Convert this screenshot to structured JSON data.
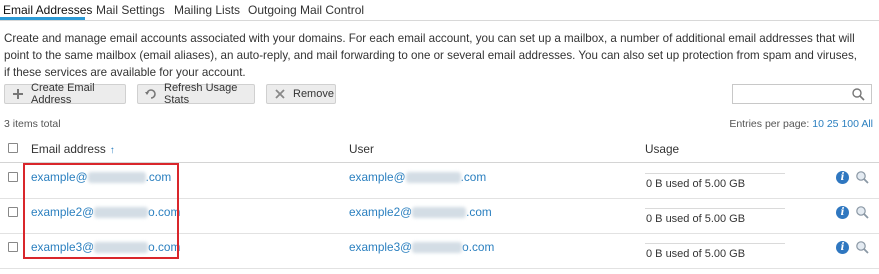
{
  "tabs": [
    {
      "label": "Email Addresses",
      "active": true
    },
    {
      "label": "Mail Settings",
      "active": false
    },
    {
      "label": "Mailing Lists",
      "active": false
    },
    {
      "label": "Outgoing Mail Control",
      "active": false
    }
  ],
  "description": "Create and manage email accounts associated with your domains. For each email account, you can set up a mailbox, a number of additional email addresses that will point to the same mailbox (email aliases), an auto-reply, and mail forwarding to one or several email addresses. You can also set up protection from spam and viruses, if these services are available for your account.",
  "toolbar": {
    "create_label": "Create Email Address",
    "refresh_label": "Refresh Usage Stats",
    "remove_label": "Remove",
    "search_placeholder": ""
  },
  "list_info": {
    "total": "3 items total",
    "entries_label": "Entries per page:",
    "page_sizes": [
      "10",
      "25",
      "100",
      "All"
    ]
  },
  "table": {
    "headers": {
      "email": "Email address",
      "user": "User",
      "usage": "Usage"
    },
    "sort_indicator": "↑",
    "rows": [
      {
        "email_prefix": "example@",
        "email_suffix": ".com",
        "user_prefix": "example@",
        "user_suffix": ".com",
        "usage": "0 B used of 5.00 GB"
      },
      {
        "email_prefix": "example2@",
        "email_suffix": "o.com",
        "user_prefix": "example2@",
        "user_suffix": ".com",
        "usage": "0 B used of 5.00 GB"
      },
      {
        "email_prefix": "example3@",
        "email_suffix": "o.com",
        "user_prefix": "example3@",
        "user_suffix": "o.com",
        "usage": "0 B used of 5.00 GB"
      }
    ]
  },
  "colors": {
    "accent": "#2b9ad6",
    "link": "#2a7fbf",
    "highlight": "#d9262b"
  }
}
